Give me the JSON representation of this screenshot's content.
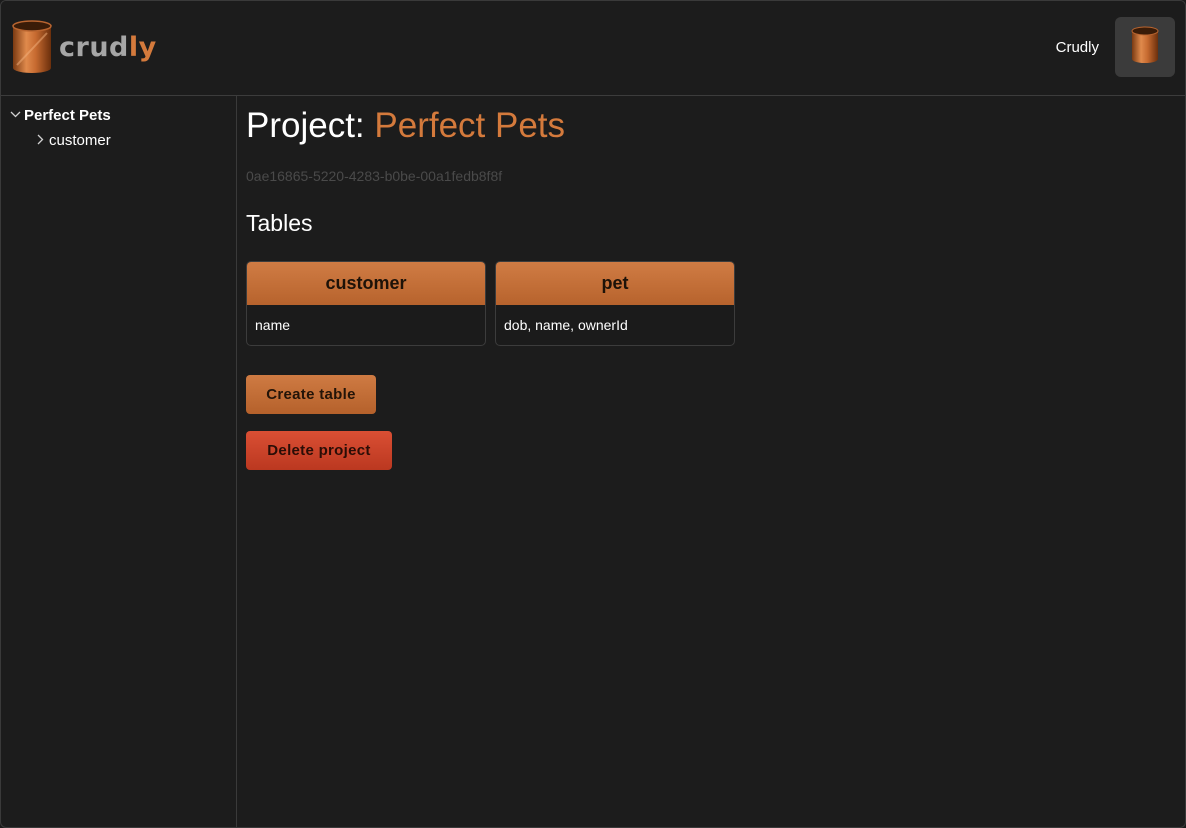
{
  "header": {
    "logo": {
      "text_part1": "crud",
      "text_part2": "ly",
      "icon": "cylinder-logo-icon"
    },
    "user_name": "Crudly",
    "avatar_icon": "cylinder-avatar-icon"
  },
  "sidebar": {
    "project": {
      "label": "Perfect Pets",
      "expanded": true,
      "icon": "chevron-down-icon"
    },
    "tables": [
      {
        "label": "customer",
        "icon": "chevron-right-icon"
      }
    ]
  },
  "main": {
    "title_prefix": "Project:",
    "title_name": "Perfect Pets",
    "project_id": "0ae16865-5220-4283-b0be-00a1fedb8f8f",
    "tables_heading": "Tables",
    "tables": [
      {
        "name": "customer",
        "columns": "name"
      },
      {
        "name": "pet",
        "columns": "dob, name, ownerId"
      }
    ],
    "create_table_label": "Create table",
    "delete_project_label": "Delete project"
  },
  "colors": {
    "accent": "#d47a3c",
    "danger": "#d04428",
    "background": "#1c1c1c",
    "border": "#3a3a3a"
  }
}
